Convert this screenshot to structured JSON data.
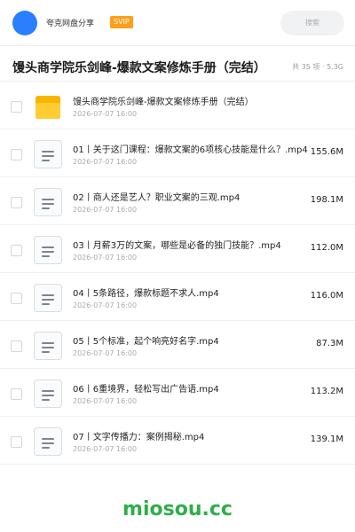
{
  "header": {
    "user_name": "夸克网盘分享",
    "badge": "SVIP",
    "search_label": "搜索"
  },
  "title_bar": {
    "title": "馒头商学院乐剑峰-爆款文案修炼手册（完结）",
    "meta": "共 35 项 · 5.3G"
  },
  "files": [
    {
      "name": "馒头商学院乐剑峰-爆款文案修炼手册（完结）",
      "date": "2026-07-07 16:00",
      "size": "",
      "type": "folder"
    },
    {
      "name": "01丨关于这门课程：爆款文案的6项核心技能是什么？.mp4",
      "date": "2026-07-07 16:00",
      "size": "155.6M",
      "type": "file"
    },
    {
      "name": "02丨商人还是艺人？职业文案的三观.mp4",
      "date": "2026-07-07 16:00",
      "size": "198.1M",
      "type": "file"
    },
    {
      "name": "03丨月薪3万的文案，哪些是必备的独门技能？.mp4",
      "date": "2026-07-07 16:00",
      "size": "112.0M",
      "type": "file"
    },
    {
      "name": "04丨5条路径，爆款标题不求人.mp4",
      "date": "2026-07-07 16:00",
      "size": "116.0M",
      "type": "file"
    },
    {
      "name": "05丨5个标准，起个响亮好名字.mp4",
      "date": "2026-07-07 16:00",
      "size": "87.3M",
      "type": "file"
    },
    {
      "name": "06丨6重境界，轻松写出广告语.mp4",
      "date": "2026-07-07 16:00",
      "size": "113.2M",
      "type": "file"
    },
    {
      "name": "07丨文字传播力：案例揭秘.mp4",
      "date": "2026-07-07 16:00",
      "size": "139.1M",
      "type": "file"
    }
  ],
  "watermark": "miosou.cc",
  "colors": {
    "accent": "#2a7fff",
    "badge": "#ff9f1a",
    "folder": "#ffcc33",
    "watermark": "#2fae4a"
  }
}
